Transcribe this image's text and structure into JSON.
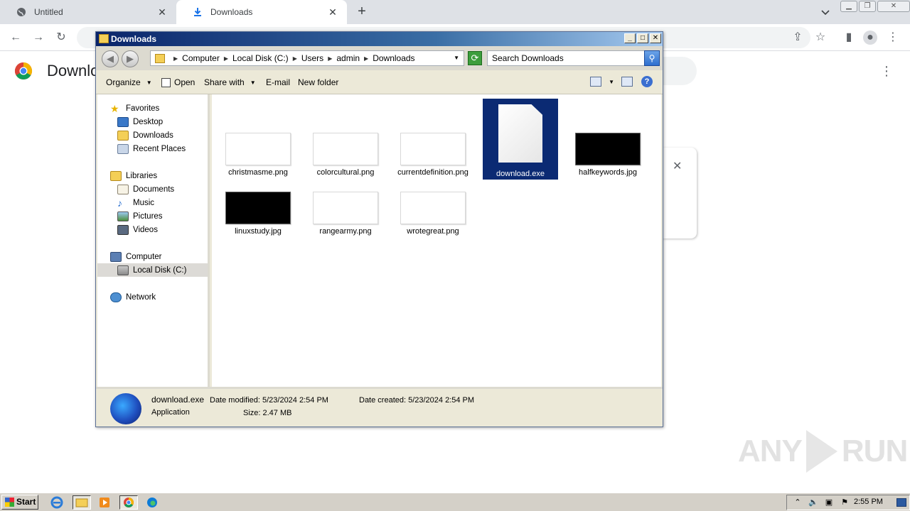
{
  "browser": {
    "tabs": [
      {
        "label": "Untitled",
        "icon": "globe-icon"
      },
      {
        "label": "Downloads",
        "icon": "download-icon"
      }
    ],
    "page_title": "Downlo"
  },
  "explorer": {
    "title": "Downloads",
    "breadcrumb": [
      "Computer",
      "Local Disk (C:)",
      "Users",
      "admin",
      "Downloads"
    ],
    "search_placeholder": "Search Downloads",
    "commands": {
      "organize": "Organize",
      "open": "Open",
      "share_with": "Share with",
      "email": "E-mail",
      "new_folder": "New folder"
    },
    "nav": {
      "favorites": "Favorites",
      "desktop": "Desktop",
      "downloads": "Downloads",
      "recent": "Recent Places",
      "libraries": "Libraries",
      "documents": "Documents",
      "music": "Music",
      "pictures": "Pictures",
      "videos": "Videos",
      "computer": "Computer",
      "local_disk": "Local Disk (C:)",
      "network": "Network"
    },
    "files": [
      {
        "name": "christmasme.png"
      },
      {
        "name": "colorcultural.png"
      },
      {
        "name": "currentdefinition.png"
      },
      {
        "name": "download.exe",
        "selected": true
      },
      {
        "name": "halfkeywords.jpg"
      },
      {
        "name": "linuxstudy.jpg"
      },
      {
        "name": "rangearmy.png"
      },
      {
        "name": "wrotegreat.png"
      }
    ],
    "details": {
      "name": "download.exe",
      "type": "Application",
      "date_modified": "Date modified: 5/23/2024 2:54 PM",
      "size": "Size: 2.47 MB",
      "date_created": "Date created: 5/23/2024 2:54 PM"
    }
  },
  "taskbar": {
    "start": "Start",
    "clock": "2:55 PM"
  },
  "watermark": {
    "left": "ANY",
    "right": "RUN"
  }
}
